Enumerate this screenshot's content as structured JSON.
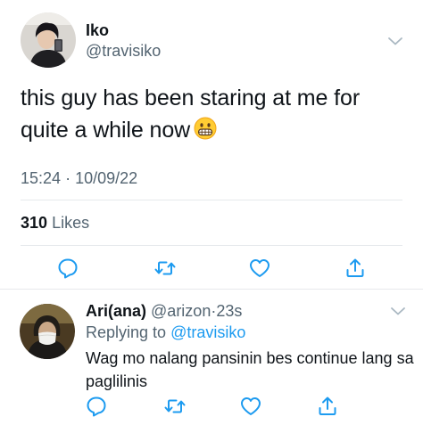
{
  "tweet": {
    "display_name": "Iko",
    "handle": "@travisiko",
    "text": "this guy has been staring at me for quite a while now",
    "emoji": "grimacing-face",
    "time": "15:24",
    "separator": "·",
    "date": "10/09/22",
    "likes_count": "310",
    "likes_label": "Likes"
  },
  "reply": {
    "display_name": "Ari(ana)",
    "handle": "@arizon",
    "dot": "·",
    "time": "23s",
    "replying_label": "Replying to",
    "replying_to": "@travisiko",
    "text": "Wag mo nalang pansinin bes continue lang sa paglilinis"
  },
  "icons": [
    "reply-icon",
    "retweet-icon",
    "like-icon",
    "share-icon",
    "chevron-down-icon"
  ],
  "colors": {
    "text": "#0f1419",
    "secondary": "#536471",
    "link": "#1d9bf0",
    "divider": "#e6e9ec"
  }
}
